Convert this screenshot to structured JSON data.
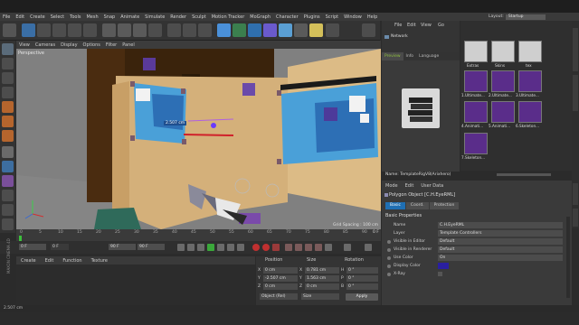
{
  "menu": [
    "File",
    "Edit",
    "Create",
    "Select",
    "Tools",
    "Mesh",
    "Snap",
    "Animate",
    "Simulate",
    "Render",
    "Sculpt",
    "Motion Tracker",
    "MoGraph",
    "Character",
    "Plugins",
    "Script",
    "Window",
    "Help"
  ],
  "layout": {
    "label": "Layout:",
    "value": "Startup"
  },
  "viewport": {
    "menu": [
      "View",
      "Cameras",
      "Display",
      "Options",
      "Filter",
      "Panel"
    ],
    "label": "Perspective",
    "grid_spacing": "Grid Spacing : 100 cm",
    "distance": "2.507 cm"
  },
  "timeline": {
    "ticks": [
      "0",
      "5",
      "10",
      "15",
      "20",
      "25",
      "30",
      "35",
      "40",
      "45",
      "50",
      "55",
      "60",
      "65",
      "70",
      "75",
      "80",
      "85",
      "90"
    ],
    "end_label": "0 F"
  },
  "transport": {
    "start": "0 F",
    "current": "0 F",
    "end": "90 F",
    "max": "90 F"
  },
  "materials": {
    "menu": [
      "Create",
      "Edit",
      "Function",
      "Texture"
    ]
  },
  "coordinates": {
    "headers": [
      "Position",
      "Size",
      "Rotation"
    ],
    "rows": [
      {
        "axis": "X",
        "pos": "0 cm",
        "size_axis": "X",
        "size": "0.781 cm",
        "rot_axis": "H",
        "rot": "0 °"
      },
      {
        "axis": "Y",
        "pos": "-2.507 cm",
        "size_axis": "Y",
        "size": "1.563 cm",
        "rot_axis": "P",
        "rot": "0 °"
      },
      {
        "axis": "Z",
        "pos": "0 cm",
        "size_axis": "Z",
        "size": "0 cm",
        "rot_axis": "B",
        "rot": "0 °"
      }
    ],
    "mode": "Object (Rel)",
    "size_mode": "Size",
    "apply": "Apply"
  },
  "status": {
    "text": "2.507 cm"
  },
  "maxon": "MAXON CINEMA 4D",
  "objects": {
    "menu": [
      "File",
      "Edit",
      "View",
      "Go"
    ],
    "item": "Network"
  },
  "preview": {
    "tabs": [
      "Preview",
      "Info",
      "Language"
    ],
    "name": "Name: TemplateRigV8(Arixhero)"
  },
  "browser": {
    "items": [
      {
        "label": "Extras"
      },
      {
        "label": "Skins"
      },
      {
        "label": "tex"
      },
      {
        "label": "1.Ultimate..."
      },
      {
        "label": "2.Ultimate..."
      },
      {
        "label": "3.Ultimate..."
      },
      {
        "label": "4.Animati..."
      },
      {
        "label": "5.Animati..."
      },
      {
        "label": "6.Skeleton..."
      },
      {
        "label": "7.Skeleton..."
      }
    ]
  },
  "attributes": {
    "menu": [
      "Mode",
      "Edit",
      "User Data"
    ],
    "object": "Polygon Object [C.H.EyeRML]",
    "tabs": [
      "Basic",
      "Coord.",
      "Protection"
    ],
    "section": "Basic Properties",
    "rows": [
      {
        "key": "Name",
        "value": "C.H.EyeRML"
      },
      {
        "key": "Layer",
        "value": "Template Controllers"
      },
      {
        "key": "Visible in Editor",
        "value": "Default"
      },
      {
        "key": "Visible in Renderer",
        "value": "Default"
      },
      {
        "key": "Use Color",
        "value": "On"
      },
      {
        "key": "Display Color",
        "value": ""
      },
      {
        "key": "X-Ray",
        "value": ""
      }
    ]
  },
  "side_tabs": [
    "Content Browser",
    "Structure",
    "Attributes",
    "Layers"
  ],
  "colors": {
    "accent": "#1f6fb3",
    "purple": "#5a2d8a",
    "green": "#8fbf3f"
  }
}
